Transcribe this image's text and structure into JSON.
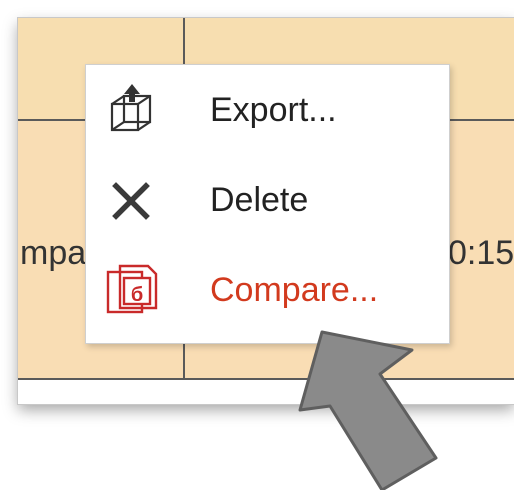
{
  "table": {
    "left_cell_text": "mpa",
    "right_cell_text": "0:15"
  },
  "context_menu": {
    "items": [
      {
        "label": "Export...",
        "icon": "export-cube-icon"
      },
      {
        "label": "Delete",
        "icon": "close-x-icon"
      },
      {
        "label": "Compare...",
        "icon": "compare-document-icon",
        "color": "#d23a1e"
      }
    ]
  },
  "colors": {
    "table_background": "#f7deb0",
    "grid_lines": "#5a5a5a",
    "menu_background": "#ffffff",
    "accent_red": "#d23a1e",
    "pointer_arrow": "#8a8a8a"
  },
  "pointer": {
    "icon": "pointer-arrow-icon"
  }
}
